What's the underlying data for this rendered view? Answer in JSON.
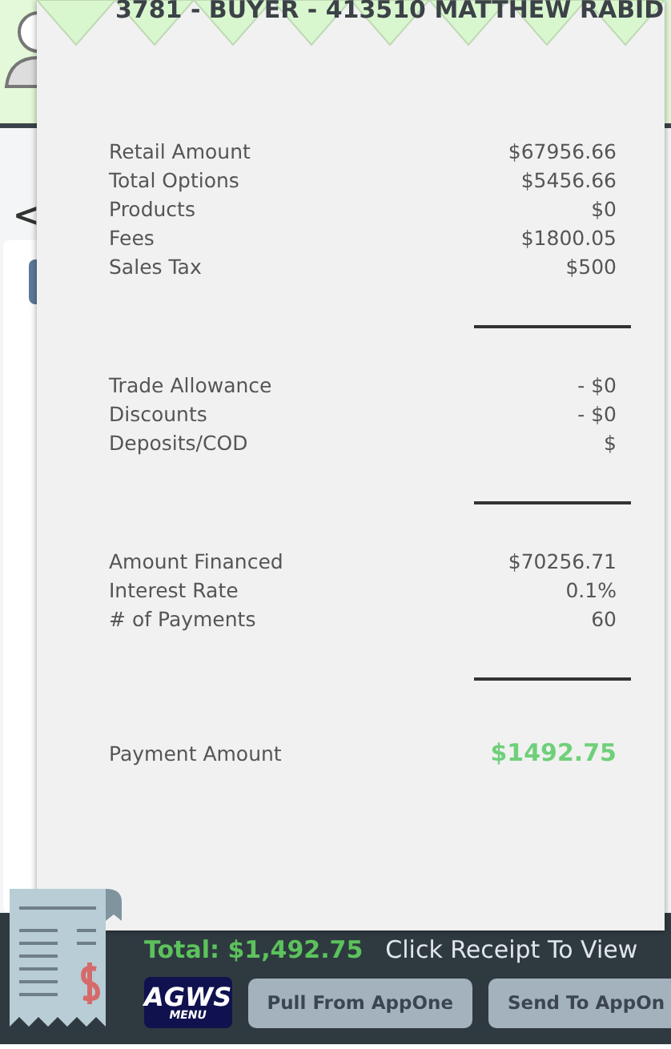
{
  "header": {
    "title": "3781 - BUYER - 413510 MATTHEW RABID"
  },
  "back": {
    "symbol": "<"
  },
  "receipt": {
    "sections": [
      {
        "rows": [
          {
            "label": "Retail Amount",
            "value": "$67956.66"
          },
          {
            "label": "Total Options",
            "value": "$5456.66"
          },
          {
            "label": "Products",
            "value": "$0"
          },
          {
            "label": "Fees",
            "value": "$1800.05"
          },
          {
            "label": "Sales Tax",
            "value": "$500"
          }
        ]
      },
      {
        "rows": [
          {
            "label": "Trade Allowance",
            "value": "- $0"
          },
          {
            "label": "Discounts",
            "value": "- $0"
          },
          {
            "label": "Deposits/COD",
            "value": "$"
          }
        ]
      },
      {
        "rows": [
          {
            "label": "Amount Financed",
            "value": "$70256.71"
          },
          {
            "label": "Interest Rate",
            "value": "0.1%"
          },
          {
            "label": "# of Payments",
            "value": "60"
          }
        ]
      }
    ],
    "payment": {
      "label": "Payment Amount",
      "value": "$1492.75"
    }
  },
  "footer": {
    "total": "Total: $1,492.75",
    "hint": "Click Receipt To View",
    "logo": {
      "title": "AGWS",
      "subtitle": "MENU"
    },
    "buttons": [
      "Pull From AppOne",
      "Send To AppOn"
    ]
  }
}
